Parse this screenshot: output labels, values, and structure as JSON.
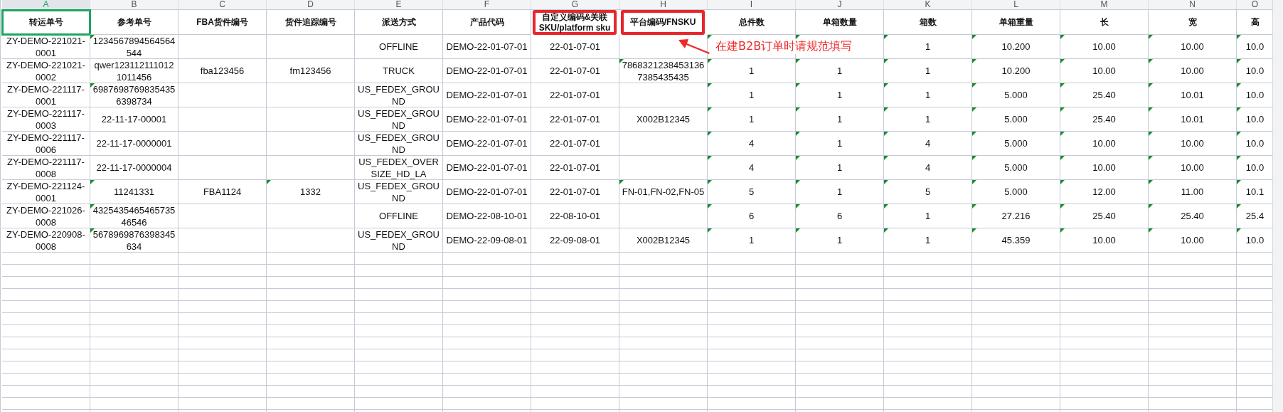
{
  "sheet": {
    "columns": [
      {
        "letter": "A",
        "title": "转运单号",
        "selected": true,
        "highlighted": false
      },
      {
        "letter": "B",
        "title": "参考单号",
        "selected": false,
        "highlighted": false
      },
      {
        "letter": "C",
        "title": "FBA货件编号",
        "selected": false,
        "highlighted": false
      },
      {
        "letter": "D",
        "title": "货件追踪编号",
        "selected": false,
        "highlighted": false
      },
      {
        "letter": "E",
        "title": "派送方式",
        "selected": false,
        "highlighted": false
      },
      {
        "letter": "F",
        "title": "产品代码",
        "selected": false,
        "highlighted": false
      },
      {
        "letter": "G",
        "title": "自定义编码&关联SKU/platform sku",
        "selected": false,
        "highlighted": true
      },
      {
        "letter": "H",
        "title": "平台编码/FNSKU",
        "selected": false,
        "highlighted": true
      },
      {
        "letter": "I",
        "title": "总件数",
        "selected": false,
        "highlighted": false
      },
      {
        "letter": "J",
        "title": "单箱数量",
        "selected": false,
        "highlighted": false
      },
      {
        "letter": "K",
        "title": "箱数",
        "selected": false,
        "highlighted": false
      },
      {
        "letter": "L",
        "title": "单箱重量",
        "selected": false,
        "highlighted": false
      },
      {
        "letter": "M",
        "title": "长",
        "selected": false,
        "highlighted": false
      },
      {
        "letter": "N",
        "title": "宽",
        "selected": false,
        "highlighted": false
      },
      {
        "letter": "O",
        "title": "高",
        "selected": false,
        "highlighted": false
      }
    ],
    "rows": [
      {
        "cells": [
          {
            "text": "ZY-DEMO-221021-0001",
            "flag": false
          },
          {
            "text": "1234567894564564544",
            "flag": true
          },
          null,
          null,
          {
            "text": "OFFLINE",
            "flag": false
          },
          {
            "text": "DEMO-22-01-07-01",
            "flag": false
          },
          {
            "text": "22-01-07-01",
            "flag": false
          },
          null,
          {
            "flag": true
          },
          {
            "flag": true
          },
          {
            "text": "1",
            "flag": true
          },
          {
            "text": "10.200",
            "flag": true
          },
          {
            "text": "10.00",
            "flag": true
          },
          {
            "text": "10.00",
            "flag": true
          },
          {
            "text": "10.0",
            "flag": true
          }
        ]
      },
      {
        "cells": [
          {
            "text": "ZY-DEMO-221021-0002",
            "flag": false
          },
          {
            "text": "qwer1231121110121011456",
            "flag": false
          },
          {
            "text": "fba123456",
            "flag": false
          },
          {
            "text": "fm123456",
            "flag": false
          },
          {
            "text": "TRUCK",
            "flag": false
          },
          {
            "text": "DEMO-22-01-07-01",
            "flag": false
          },
          {
            "text": "22-01-07-01",
            "flag": false
          },
          {
            "text": "78683212384531367385435435",
            "flag": true
          },
          {
            "text": "1",
            "flag": true
          },
          {
            "text": "1",
            "flag": true
          },
          {
            "text": "1",
            "flag": true
          },
          {
            "text": "10.200",
            "flag": true
          },
          {
            "text": "10.00",
            "flag": true
          },
          {
            "text": "10.00",
            "flag": true
          },
          {
            "text": "10.0",
            "flag": true
          }
        ]
      },
      {
        "cells": [
          {
            "text": "ZY-DEMO-221117-0001",
            "flag": false
          },
          {
            "text": "69876987698354356398734",
            "flag": true
          },
          null,
          null,
          {
            "text": "US_FEDEX_GROUND",
            "flag": false
          },
          {
            "text": "DEMO-22-01-07-01",
            "flag": false
          },
          {
            "text": "22-01-07-01",
            "flag": false
          },
          null,
          {
            "text": "1",
            "flag": true
          },
          {
            "text": "1",
            "flag": true
          },
          {
            "text": "1",
            "flag": true
          },
          {
            "text": "5.000",
            "flag": true
          },
          {
            "text": "25.40",
            "flag": true
          },
          {
            "text": "10.01",
            "flag": true
          },
          {
            "text": "10.0",
            "flag": true
          }
        ]
      },
      {
        "cells": [
          {
            "text": "ZY-DEMO-221117-0003",
            "flag": false
          },
          {
            "text": "22-11-17-00001",
            "flag": false
          },
          null,
          null,
          {
            "text": "US_FEDEX_GROUND",
            "flag": false
          },
          {
            "text": "DEMO-22-01-07-01",
            "flag": false
          },
          {
            "text": "22-01-07-01",
            "flag": false
          },
          {
            "text": "X002B12345",
            "flag": false
          },
          {
            "text": "1",
            "flag": true
          },
          {
            "text": "1",
            "flag": true
          },
          {
            "text": "1",
            "flag": true
          },
          {
            "text": "5.000",
            "flag": true
          },
          {
            "text": "25.40",
            "flag": true
          },
          {
            "text": "10.01",
            "flag": true
          },
          {
            "text": "10.0",
            "flag": true
          }
        ]
      },
      {
        "cells": [
          {
            "text": "ZY-DEMO-221117-0006",
            "flag": false
          },
          {
            "text": "22-11-17-0000001",
            "flag": false
          },
          null,
          null,
          {
            "text": "US_FEDEX_GROUND",
            "flag": false
          },
          {
            "text": "DEMO-22-01-07-01",
            "flag": false
          },
          {
            "text": "22-01-07-01",
            "flag": false
          },
          null,
          {
            "text": "4",
            "flag": true
          },
          {
            "text": "1",
            "flag": true
          },
          {
            "text": "4",
            "flag": true
          },
          {
            "text": "5.000",
            "flag": true
          },
          {
            "text": "10.00",
            "flag": true
          },
          {
            "text": "10.00",
            "flag": true
          },
          {
            "text": "10.0",
            "flag": true
          }
        ]
      },
      {
        "cells": [
          {
            "text": "ZY-DEMO-221117-0008",
            "flag": false
          },
          {
            "text": "22-11-17-0000004",
            "flag": false
          },
          null,
          null,
          {
            "text": "US_FEDEX_OVERSIZE_HD_LA",
            "flag": false
          },
          {
            "text": "DEMO-22-01-07-01",
            "flag": false
          },
          {
            "text": "22-01-07-01",
            "flag": false
          },
          null,
          {
            "text": "4",
            "flag": true
          },
          {
            "text": "1",
            "flag": true
          },
          {
            "text": "4",
            "flag": true
          },
          {
            "text": "5.000",
            "flag": true
          },
          {
            "text": "10.00",
            "flag": true
          },
          {
            "text": "10.00",
            "flag": true
          },
          {
            "text": "10.0",
            "flag": true
          }
        ]
      },
      {
        "cells": [
          {
            "text": "ZY-DEMO-221124-0001",
            "flag": false
          },
          {
            "text": "11241331",
            "flag": true
          },
          {
            "text": "FBA1124",
            "flag": false
          },
          {
            "text": "1332",
            "flag": true
          },
          {
            "text": "US_FEDEX_GROUND",
            "flag": false
          },
          {
            "text": "DEMO-22-01-07-01",
            "flag": false
          },
          {
            "text": "22-01-07-01",
            "flag": false
          },
          {
            "text": "FN-01,FN-02,FN-05",
            "flag": true
          },
          {
            "text": "5",
            "flag": true
          },
          {
            "text": "1",
            "flag": true
          },
          {
            "text": "5",
            "flag": true
          },
          {
            "text": "5.000",
            "flag": true
          },
          {
            "text": "12.00",
            "flag": true
          },
          {
            "text": "11.00",
            "flag": true
          },
          {
            "text": "10.1",
            "flag": true
          }
        ]
      },
      {
        "cells": [
          {
            "text": "ZY-DEMO-221026-0008",
            "flag": false
          },
          {
            "text": "432543546546573546546",
            "flag": true
          },
          null,
          null,
          {
            "text": "OFFLINE",
            "flag": false
          },
          {
            "text": "DEMO-22-08-10-01",
            "flag": false
          },
          {
            "text": "22-08-10-01",
            "flag": false
          },
          null,
          {
            "text": "6",
            "flag": true
          },
          {
            "text": "6",
            "flag": true
          },
          {
            "text": "1",
            "flag": true
          },
          {
            "text": "27.216",
            "flag": true
          },
          {
            "text": "25.40",
            "flag": true
          },
          {
            "text": "25.40",
            "flag": true
          },
          {
            "text": "25.4",
            "flag": true
          }
        ]
      },
      {
        "cells": [
          {
            "text": "ZY-DEMO-220908-0008",
            "flag": false
          },
          {
            "text": "5678969876398345634",
            "flag": true
          },
          null,
          null,
          {
            "text": "US_FEDEX_GROUND",
            "flag": false
          },
          {
            "text": "DEMO-22-09-08-01",
            "flag": false
          },
          {
            "text": "22-09-08-01",
            "flag": false
          },
          {
            "text": "X002B12345",
            "flag": false
          },
          {
            "text": "1",
            "flag": true
          },
          {
            "text": "1",
            "flag": true
          },
          {
            "text": "1",
            "flag": true
          },
          {
            "text": "45.359",
            "flag": true
          },
          {
            "text": "10.00",
            "flag": true
          },
          {
            "text": "10.00",
            "flag": true
          },
          {
            "text": "10.0",
            "flag": true
          }
        ]
      }
    ]
  },
  "annotation": {
    "text": "在建B2B订单时请规范填写"
  }
}
